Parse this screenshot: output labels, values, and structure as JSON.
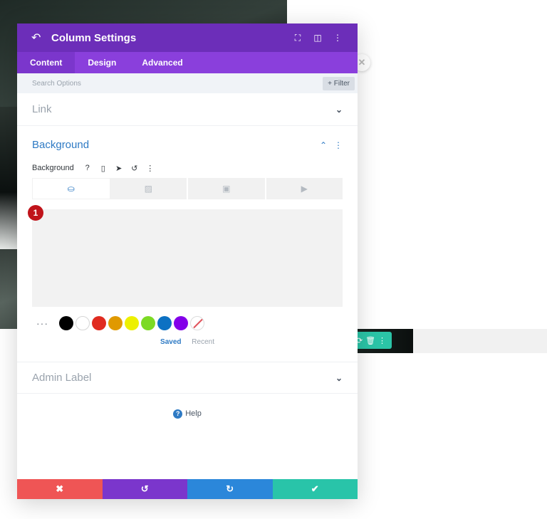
{
  "modal": {
    "title": "Column Settings",
    "icons": {
      "back": "↶",
      "fullscreen": "⛶",
      "split": "◫",
      "more": "⋮"
    }
  },
  "tabs": [
    {
      "label": "Content",
      "active": true
    },
    {
      "label": "Design",
      "active": false
    },
    {
      "label": "Advanced",
      "active": false
    }
  ],
  "search": {
    "placeholder": "Search Options",
    "filter_label": "+ Filter"
  },
  "sections": {
    "link": {
      "title": "Link",
      "expanded": false
    },
    "background": {
      "title": "Background",
      "expanded": true,
      "field_label": "Background",
      "field_icons": {
        "help": "?",
        "device": "▯",
        "hover": "➤",
        "reset": "↺",
        "more": "⋮"
      },
      "type_tabs": [
        {
          "name": "color",
          "glyph": "⛀",
          "active": true
        },
        {
          "name": "gradient",
          "glyph": "▨",
          "active": false
        },
        {
          "name": "image",
          "glyph": "▣",
          "active": false
        },
        {
          "name": "video",
          "glyph": "▶",
          "active": false
        }
      ],
      "annotation_badge": "1",
      "swatch_more": "···",
      "swatches": [
        "#000000",
        "#ffffff",
        "#e02b20",
        "#e09900",
        "#edf000",
        "#7cda24",
        "#0c71c3",
        "#8300e9"
      ],
      "palette_tabs": {
        "saved": "Saved",
        "recent": "Recent"
      }
    },
    "admin_label": {
      "title": "Admin Label",
      "expanded": false
    }
  },
  "help": {
    "icon": "?",
    "label": "Help"
  },
  "footer": {
    "cancel": "✖",
    "undo": "↺",
    "redo": "↻",
    "save": "✔"
  },
  "colors": {
    "header": "#6c2eb9",
    "tabs": "#8a3fdc",
    "accent_blue": "#2e7ac4",
    "cancel": "#ef5555",
    "undo": "#7b36cc",
    "redo": "#2b87da",
    "save": "#29c4a9",
    "badge": "#c0131a"
  },
  "page_toolbar": {
    "icons": [
      "⟳",
      "🗑",
      "⋮"
    ]
  }
}
